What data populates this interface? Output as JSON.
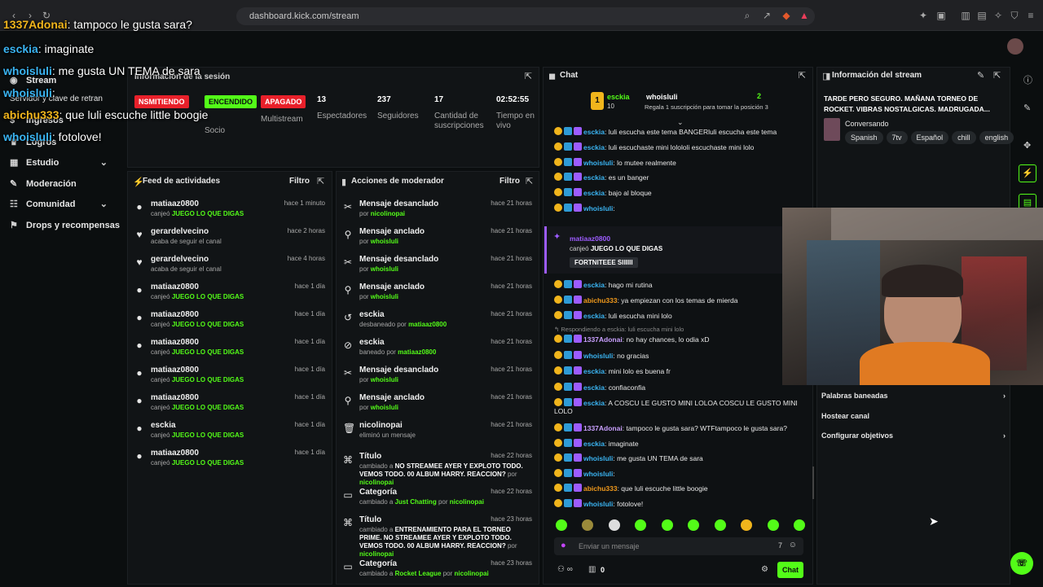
{
  "browser": {
    "url": "dashboard.kick.com/stream"
  },
  "overlay_chat": [
    {
      "user": "1337Adonai",
      "text": ": tampoco le gusta sara?"
    },
    {
      "user": "esckia",
      "text": ": imaginate"
    },
    {
      "user": "whoisluli",
      "text": ": me gusta UN TEMA de sara"
    },
    {
      "user": "whoisluli",
      "text": ":"
    },
    {
      "user": "abichu333",
      "text": ": que luli escuche little boogie"
    },
    {
      "user": "whoisluli",
      "text": ": fotolove!"
    }
  ],
  "sidebar": {
    "items": [
      {
        "label": "Stream",
        "icon": "stream-icon"
      },
      {
        "label": "Servidor y clave de retran",
        "icon": "key-icon"
      },
      {
        "label": "Ingresos",
        "icon": "money-icon"
      },
      {
        "label": "Logros",
        "icon": "trophy-icon"
      },
      {
        "label": "Estudio",
        "icon": "studio-icon"
      },
      {
        "label": "Moderación",
        "icon": "wrench-icon"
      },
      {
        "label": "Comunidad",
        "icon": "community-icon"
      },
      {
        "label": "Drops y recompensas",
        "icon": "gift-icon"
      }
    ]
  },
  "session": {
    "title": "Información de la sesión",
    "status_live": "NSMITIENDO",
    "status_on": "ENCENDIDO",
    "status_off": "APAGADO",
    "socio_label": "Socio",
    "multistream_label": "Multistream",
    "viewers": "13",
    "viewers_label": "Espectadores",
    "followers": "237",
    "followers_label": "Seguidores",
    "subs": "17",
    "subs_label": "Cantidad de suscripciones",
    "uptime": "02:52:55",
    "uptime_label": "Tiempo en vivo"
  },
  "activity_feed": {
    "title": "Feed de actividades",
    "filter": "Filtro",
    "rows": [
      {
        "name": "matiaaz0800",
        "sub": "canjeó",
        "reward": "JUEGO LO QUE DIGAS",
        "time": "hace 1 minuto",
        "icon": "redeem-icon"
      },
      {
        "name": "gerardelvecino",
        "sub": "acaba de seguir el canal",
        "reward": "",
        "time": "hace 2 horas",
        "icon": "heart-icon"
      },
      {
        "name": "gerardelvecino",
        "sub": "acaba de seguir el canal",
        "reward": "",
        "time": "hace 4 horas",
        "icon": "heart-icon"
      },
      {
        "name": "matiaaz0800",
        "sub": "canjeó",
        "reward": "JUEGO LO QUE DIGAS",
        "time": "hace 1 día",
        "icon": "redeem-icon"
      },
      {
        "name": "matiaaz0800",
        "sub": "canjeó",
        "reward": "JUEGO LO QUE DIGAS",
        "time": "hace 1 día",
        "icon": "redeem-icon"
      },
      {
        "name": "matiaaz0800",
        "sub": "canjeó",
        "reward": "JUEGO LO QUE DIGAS",
        "time": "hace 1 día",
        "icon": "redeem-icon"
      },
      {
        "name": "matiaaz0800",
        "sub": "canjeó",
        "reward": "JUEGO LO QUE DIGAS",
        "time": "hace 1 día",
        "icon": "redeem-icon"
      },
      {
        "name": "matiaaz0800",
        "sub": "canjeó",
        "reward": "JUEGO LO QUE DIGAS",
        "time": "hace 1 día",
        "icon": "redeem-icon"
      },
      {
        "name": "esckia",
        "sub": "canjeó",
        "reward": "JUEGO LO QUE DIGAS",
        "time": "hace 1 día",
        "icon": "redeem-icon"
      },
      {
        "name": "matiaaz0800",
        "sub": "canjeó",
        "reward": "JUEGO LO QUE DIGAS",
        "time": "hace 1 día",
        "icon": "redeem-icon"
      }
    ]
  },
  "mod_actions": {
    "title": "Acciones de moderador",
    "filter": "Filtro",
    "rows": [
      {
        "name": "Mensaje desanclado",
        "pre": "por",
        "who": "nicolinopai",
        "time": "hace 21 horas",
        "icon": "unpin-icon"
      },
      {
        "name": "Mensaje anclado",
        "pre": "por",
        "who": "whoisluli",
        "time": "hace 21 horas",
        "icon": "pin-icon"
      },
      {
        "name": "Mensaje desanclado",
        "pre": "por",
        "who": "whoisluli",
        "time": "hace 21 horas",
        "icon": "unpin-icon"
      },
      {
        "name": "Mensaje anclado",
        "pre": "por",
        "who": "whoisluli",
        "time": "hace 21 horas",
        "icon": "pin-icon"
      },
      {
        "name": "esckia",
        "pre": "desbaneado por",
        "who": "matiaaz0800",
        "time": "hace 21 horas",
        "icon": "undo-icon"
      },
      {
        "name": "esckia",
        "pre": "baneado por",
        "who": "matiaaz0800",
        "time": "hace 21 horas",
        "icon": "ban-icon"
      },
      {
        "name": "Mensaje desanclado",
        "pre": "por",
        "who": "whoisluli",
        "time": "hace 21 horas",
        "icon": "unpin-icon"
      },
      {
        "name": "Mensaje anclado",
        "pre": "por",
        "who": "whoisluli",
        "time": "hace 21 horas",
        "icon": "pin-icon"
      },
      {
        "name": "nicolinopai",
        "pre": "eliminó un mensaje",
        "who": "",
        "time": "hace 21 horas",
        "icon": "trash-icon"
      }
    ],
    "title_change_1": {
      "name": "Título",
      "pre": "cambiado a",
      "text": "NO STREAMEE AYER Y EXPLOTO TODO. VEMOS TODO. 00 ALBUM HARRY. REACCION?",
      "who": "nicolinopai",
      "time": "hace 22 horas"
    },
    "category_change_1": {
      "name": "Categoría",
      "pre": "cambiado a",
      "text": "Just Chatting",
      "who": "nicolinopai",
      "time": "hace 22 horas"
    },
    "title_change_2": {
      "name": "Título",
      "pre": "cambiado a",
      "text": "ENTRENAMIENTO PARA EL TORNEO PRIME. NO STREAMEE AYER Y EXPLOTO TODO. VEMOS TODO. 00 ALBUM HARRY. REACCION?",
      "who": "nicolinopai",
      "time": "hace 23 horas"
    },
    "category_change_2": {
      "name": "Categoría",
      "pre": "cambiado a",
      "text": "Rocket League",
      "who": "nicolinopai",
      "time": "hace 23 horas"
    },
    "by": "por"
  },
  "chat": {
    "title": "Chat",
    "pinned_user": "esckia",
    "pinned_target": "whoisluli",
    "pinned_count": "2",
    "pinned_level": "10",
    "pinned_text": "Regala 1 suscripción para tomar la posición 3",
    "messages": [
      {
        "user": "esckia",
        "color": "u-blue",
        "text": ": luli escucha este tema BANGERluli escucha este tema"
      },
      {
        "user": "esckia",
        "color": "u-blue",
        "text": ": luli escuchaste mini lolololi escuchaste mini lolo"
      },
      {
        "user": "whoisluli",
        "color": "u-blue",
        "text": ": lo mutee realmente"
      },
      {
        "user": "esckia",
        "color": "u-blue",
        "text": ": es un banger"
      },
      {
        "user": "esckia",
        "color": "u-blue",
        "text": ": bajo al bloque"
      },
      {
        "user": "whoisluli",
        "color": "u-blue",
        "text": ":"
      }
    ],
    "redeem": {
      "user": "matiaaz0800",
      "text": "canjeó",
      "reward": "JUEGO LO QUE DIGAS",
      "note": "FORTNITEEE SIIIIII"
    },
    "messages2": [
      {
        "user": "esckia",
        "color": "u-blue",
        "text": ": hago mi rutina"
      },
      {
        "user": "abichu333",
        "color": "u-orange",
        "text": ": ya empiezan con los temas de mierda"
      },
      {
        "user": "esckia",
        "color": "u-blue",
        "text": ": luli escucha mini lolo"
      }
    ],
    "reply_hint": "Respondiendo a esckia: luli escucha mini lolo",
    "messages3": [
      {
        "user": "1337Adonai",
        "color": "u-pink",
        "text": ": no hay chances, lo odia xD"
      },
      {
        "user": "whoisluli",
        "color": "u-blue",
        "text": ": no gracias"
      },
      {
        "user": "esckia",
        "color": "u-blue",
        "text": ": mini lolo es buena fr"
      },
      {
        "user": "esckia",
        "color": "u-blue",
        "text": ": confiaconfia"
      },
      {
        "user": "esckia",
        "color": "u-blue",
        "text": ": A COSCU LE GUSTO MINI LOLOA COSCU LE GUSTO MINI"
      }
    ],
    "wrap_text": "LOLO",
    "messages4": [
      {
        "user": "1337Adonai",
        "color": "u-pink",
        "text": ": tampoco le gusta sara? WTFtampoco le gusta sara?"
      },
      {
        "user": "esckia",
        "color": "u-blue",
        "text": ": imaginate"
      },
      {
        "user": "whoisluli",
        "color": "u-blue",
        "text": ": me gusta UN TEMA de sara"
      },
      {
        "user": "whoisluli",
        "color": "u-blue",
        "text": ":"
      },
      {
        "user": "abichu333",
        "color": "u-orange",
        "text": ": que luli escuche little boogie"
      },
      {
        "user": "whoisluli",
        "color": "u-blue",
        "text": ": fotolove!"
      }
    ],
    "input_placeholder": "Enviar un mensaje",
    "points": "0",
    "send_label": "Chat"
  },
  "stream_info": {
    "title": "Información del stream",
    "stream_title": "TARDE PERO SEGURO. MAÑANA TORNEO DE ROCKET. VIBRAS NOSTALGICAS. MADRUGADA...",
    "category": "Conversando",
    "tags": [
      "Spanish",
      "7tv",
      "Español",
      "chill",
      "english"
    ],
    "links": [
      {
        "label": "Palabras baneadas"
      },
      {
        "label": "Hostear canal"
      },
      {
        "label": "Configurar objetivos"
      }
    ]
  },
  "colors": {
    "accent": "#53fc18",
    "live_red": "#e8202a",
    "background": "#0b0e0f",
    "panel": "#111416"
  }
}
